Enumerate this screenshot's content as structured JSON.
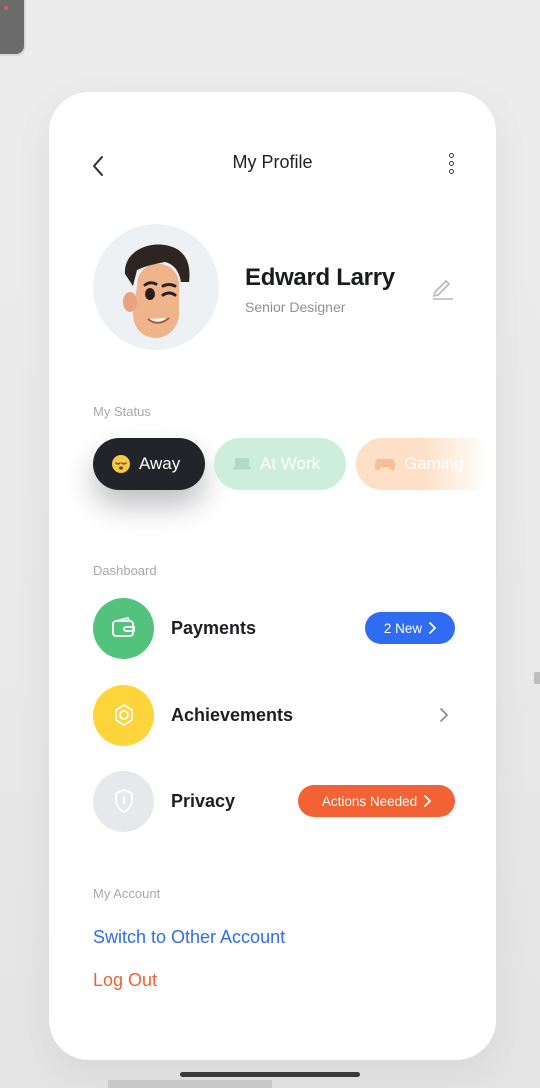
{
  "header": {
    "title": "My Profile"
  },
  "profile": {
    "name": "Edward Larry",
    "role": "Senior Designer"
  },
  "status": {
    "label": "My Status",
    "chips": [
      {
        "label": "Away",
        "icon": "sleepy-emoji-icon",
        "selected": true
      },
      {
        "label": "At Work",
        "icon": "laptop-icon",
        "selected": false
      },
      {
        "label": "Gaming",
        "icon": "gamepad-icon",
        "selected": false
      }
    ]
  },
  "dashboard": {
    "label": "Dashboard",
    "items": [
      {
        "label": "Payments",
        "icon": "wallet-icon",
        "icon_bg": "#52c27d",
        "badge": "2 New",
        "badge_color": "#2f6cf2"
      },
      {
        "label": "Achievements",
        "icon": "medal-icon",
        "icon_bg": "#ffd43b",
        "badge": "",
        "badge_color": ""
      },
      {
        "label": "Privacy",
        "icon": "shield-icon",
        "icon_bg": "#e6e8ec",
        "badge": "Actions Needed",
        "badge_color": "#f26235"
      }
    ]
  },
  "account": {
    "label": "My Account",
    "switch_label": "Switch to Other Account",
    "switch_color": "#2f6cf2",
    "logout_label": "Log Out",
    "logout_color": "#f26235"
  }
}
